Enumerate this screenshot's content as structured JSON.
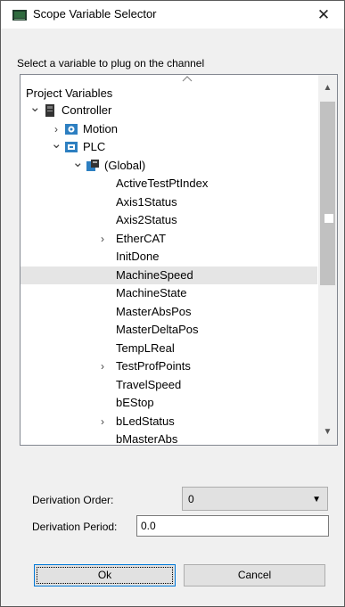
{
  "window": {
    "title": "Scope Variable Selector",
    "close_glyph": "✕"
  },
  "prompt": "Select a variable to plug on the channel",
  "tree": {
    "header": "Project Variables",
    "rows": [
      {
        "label": "Controller",
        "chevron": "expanded",
        "icon": "controller-icon"
      },
      {
        "label": "Motion",
        "chevron": "collapsed",
        "icon": "motion-icon"
      },
      {
        "label": "PLC",
        "chevron": "expanded",
        "icon": "plc-icon"
      },
      {
        "label": "(Global)",
        "chevron": "expanded",
        "icon": "global-icon"
      },
      {
        "label": "ActiveTestPtIndex",
        "chevron": "none"
      },
      {
        "label": "Axis1Status",
        "chevron": "none"
      },
      {
        "label": "Axis2Status",
        "chevron": "none"
      },
      {
        "label": "EtherCAT",
        "chevron": "collapsed"
      },
      {
        "label": "InitDone",
        "chevron": "none"
      },
      {
        "label": "MachineSpeed",
        "chevron": "none",
        "selected": true
      },
      {
        "label": "MachineState",
        "chevron": "none"
      },
      {
        "label": "MasterAbsPos",
        "chevron": "none"
      },
      {
        "label": "MasterDeltaPos",
        "chevron": "none"
      },
      {
        "label": "TempLReal",
        "chevron": "none"
      },
      {
        "label": "TestProfPoints",
        "chevron": "collapsed"
      },
      {
        "label": "TravelSpeed",
        "chevron": "none"
      },
      {
        "label": "bEStop",
        "chevron": "none"
      },
      {
        "label": "bLedStatus",
        "chevron": "collapsed"
      },
      {
        "label": "bMasterAbs",
        "chevron": "none"
      }
    ]
  },
  "derivation_order": {
    "label": "Derivation Order:",
    "value": "0"
  },
  "derivation_period": {
    "label": "Derivation Period:",
    "value": "0.0"
  },
  "buttons": {
    "ok": "Ok",
    "cancel": "Cancel"
  },
  "colors": {
    "selection": "#e5e5e5",
    "focus_border": "#0078d7",
    "icon_blue": "#2d7fc1"
  }
}
